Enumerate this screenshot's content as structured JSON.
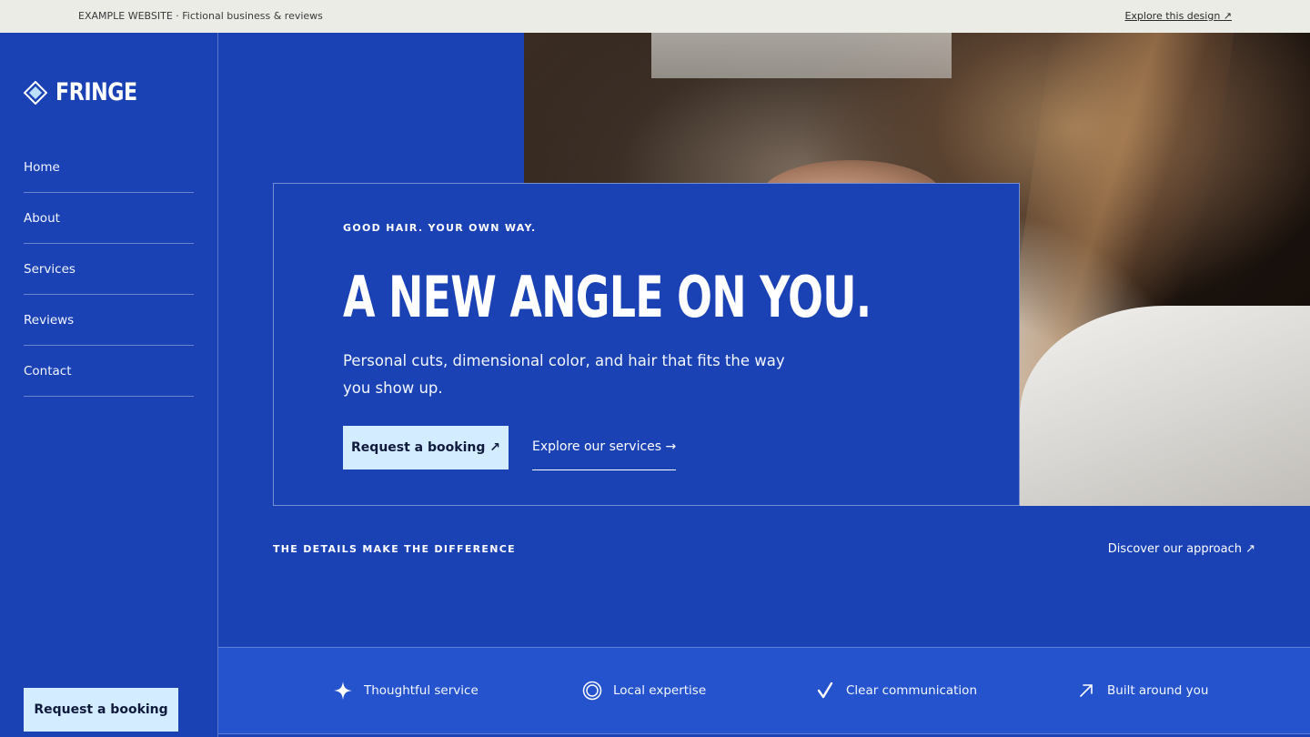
{
  "banner": {
    "site_label": "EXAMPLE WEBSITE · Fictional business & reviews",
    "explore_link": "Explore this design ↗"
  },
  "brand": {
    "name": "FRINGE",
    "logo_icon": "diamond-logo-icon"
  },
  "nav": {
    "items": [
      {
        "label": "Home"
      },
      {
        "label": "About"
      },
      {
        "label": "Services"
      },
      {
        "label": "Reviews"
      },
      {
        "label": "Contact"
      }
    ],
    "booking_button": "Request a booking"
  },
  "hero": {
    "eyebrow": "GOOD HAIR. YOUR OWN WAY.",
    "headline": "A NEW ANGLE ON YOU.",
    "subtext": "Personal cuts, dimensional color, and hair that fits the way you show up.",
    "primary_cta": "Request a booking ↗",
    "secondary_cta": "Explore our services →"
  },
  "details": {
    "heading": "THE DETAILS MAKE THE DIFFERENCE",
    "approach_link": "Discover our approach ↗"
  },
  "features": [
    {
      "label": "Thoughtful service",
      "icon": "sparkle-icon"
    },
    {
      "label": "Local expertise",
      "icon": "target-icon"
    },
    {
      "label": "Clear communication",
      "icon": "check-icon"
    },
    {
      "label": "Built around you",
      "icon": "arrow-up-right-icon"
    }
  ],
  "colors": {
    "brand_blue": "#1a42b5",
    "feature_blue": "#2453cd",
    "cta_light": "#d4ecff",
    "banner_bg": "#ecece7"
  }
}
